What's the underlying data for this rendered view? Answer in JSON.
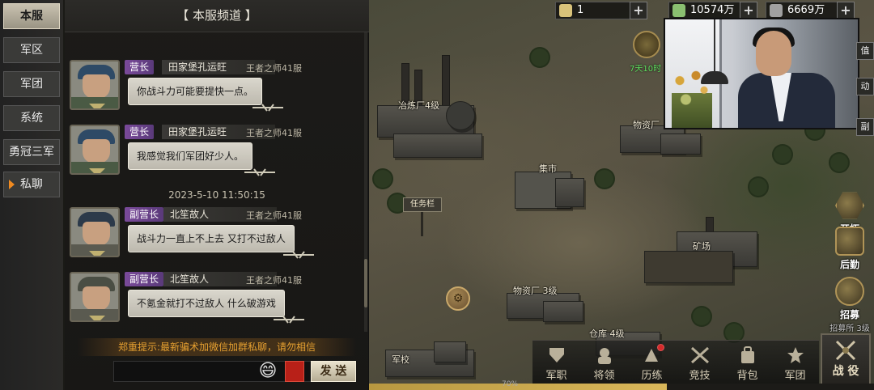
{
  "tabs": [
    {
      "label": "本服",
      "active": true
    },
    {
      "label": "军区",
      "active": false
    },
    {
      "label": "军团",
      "active": false
    },
    {
      "label": "系统",
      "active": false
    },
    {
      "label": "勇冠三军",
      "active": false
    },
    {
      "label": "私聊",
      "active": false,
      "arrow": true
    }
  ],
  "chat": {
    "title": "【 本服频道 】",
    "timestamp": "2023-5-10 11:50:15",
    "messages": [
      {
        "rank": "营长",
        "name": "田家堡孔运旺",
        "server": "王者之师41服",
        "text": "你战斗力可能要提快一点。"
      },
      {
        "rank": "营长",
        "name": "田家堡孔运旺",
        "server": "王者之师41服",
        "text": "我感觉我们军团好少人。"
      },
      {
        "rank": "副营长",
        "name": "北笙故人",
        "server": "王者之师41服",
        "text": "战斗力一直上不上去 又打不过敌人"
      },
      {
        "rank": "副营长",
        "name": "北笙故人",
        "server": "王者之师41服",
        "text": "不氪金就打不过敌人 什么破游戏"
      }
    ],
    "notice": "郑重提示:最新骗术加微信加群私聊，请勿相信",
    "input_placeholder": "",
    "emoji": "😄",
    "send_label": "发 送"
  },
  "resources": {
    "gold": "1",
    "food": "10574万",
    "steel": "6669万"
  },
  "timer": {
    "text": "7天10时"
  },
  "map_labels": {
    "smelter": "冶炼厂4级",
    "supply_top": "物资厂",
    "market": "集市",
    "task": "任务栏",
    "mine": "矿场",
    "supply_3": "物资厂 3级",
    "warehouse": "仓库 4级",
    "school": "军校"
  },
  "side_actions": {
    "explore": "开拓",
    "logistics": "后勤",
    "recruit": "招募",
    "recruit_sub": "招募所 3级"
  },
  "right_buttons": [
    "值",
    "动",
    "副"
  ],
  "bottom_nav": [
    {
      "label": "军职",
      "icon": "rank-icon"
    },
    {
      "label": "将领",
      "icon": "general-icon"
    },
    {
      "label": "历练",
      "icon": "training-icon",
      "alert": true
    },
    {
      "label": "竞技",
      "icon": "arena-icon"
    },
    {
      "label": "背包",
      "icon": "bag-icon"
    },
    {
      "label": "军团",
      "icon": "legion-icon"
    }
  ],
  "battle": {
    "label": "战 役"
  },
  "progress": {
    "text": "70%",
    "value": 0.59
  },
  "colors": {
    "accent": "#e6a030",
    "rank_bg": "#7a4a9a",
    "send_bg": "#e9e2cd"
  }
}
